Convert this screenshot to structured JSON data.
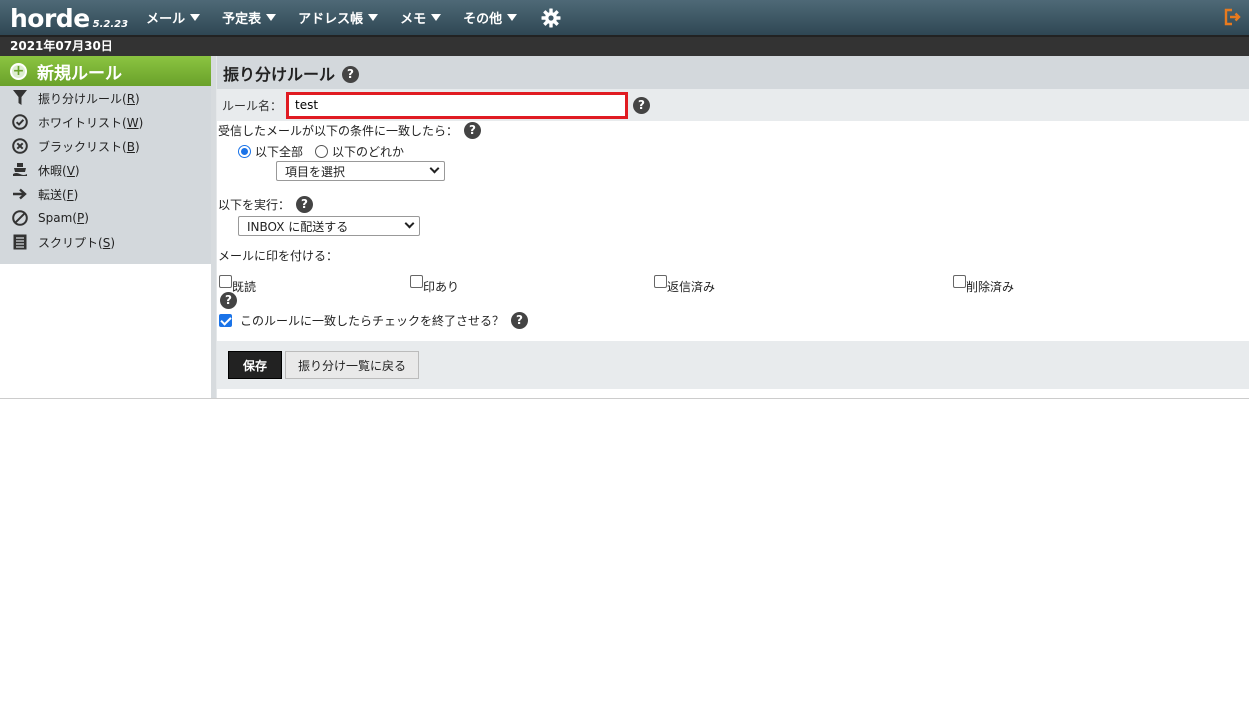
{
  "app": {
    "brand": "horde",
    "version": "5.2.23"
  },
  "menu": [
    {
      "label": "メール"
    },
    {
      "label": "予定表"
    },
    {
      "label": "アドレス帳"
    },
    {
      "label": "メモ"
    },
    {
      "label": "その他"
    }
  ],
  "date": "2021年07月30日",
  "sidebar": {
    "new_rule": "新規ルール",
    "items": [
      {
        "label": "振り分けルール",
        "key": "R"
      },
      {
        "label": "ホワイトリスト",
        "key": "W"
      },
      {
        "label": "ブラックリスト",
        "key": "B"
      },
      {
        "label": "休暇",
        "key": "V"
      },
      {
        "label": "転送",
        "key": "F"
      },
      {
        "label": "Spam",
        "key": "P"
      },
      {
        "label": "スクリプト",
        "key": "S"
      }
    ]
  },
  "page": {
    "title": "振り分けルール",
    "rule_name_label": "ルール名：",
    "rule_name_value": "test",
    "conditions_label": "受信したメールが以下の条件に一致したら：",
    "match_all": "以下全部",
    "match_any": "以下のどれか",
    "field_select": "項目を選択",
    "action_label": "以下を実行：",
    "action_select": "INBOX に配送する",
    "mark_label": "メールに印を付ける：",
    "marks": [
      "既読",
      "印あり",
      "返信済み",
      "削除済み"
    ],
    "stop_label": "このルールに一致したらチェックを終了させる？",
    "save_button": "保存",
    "back_button": "振り分け一覧に戻る",
    "help_glyph": "?"
  },
  "colors": {
    "topbar": "#3e5765",
    "new_rule_green": "#7ab536",
    "sidebar_bg": "#d3d8dc",
    "highlight_red": "#e01b22",
    "accent_blue": "#1a73e8",
    "logout_orange": "#e87a1e"
  }
}
